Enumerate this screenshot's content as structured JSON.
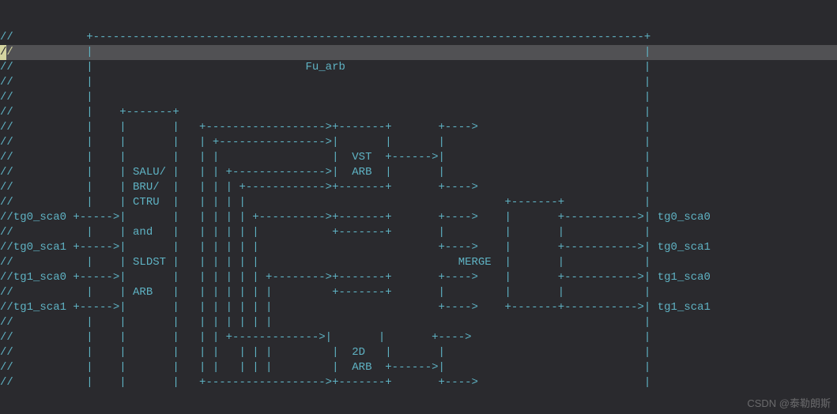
{
  "lines": [
    "//           +-----------------------------------------------------------------------------------+",
    "//           |                                                                                   |",
    "//           |                                Fu_arb                                             |",
    "//           |                                                                                   |",
    "//           |                                                                                   |",
    "//           |    +-------+                                                                      |",
    "//           |    |       |   +------------------>+-------+       +---->                         |",
    "//           |    |       |   | +---------------->|       |       |                              |",
    "//           |    |       |   | |                 |  VST  +------>|                              |",
    "//           |    | SALU/ |   | | +-------------->|  ARB  |       |                              |",
    "//           |    | BRU/  |   | | | +------------>+-------+       +---->                         |",
    "//           |    | CTRU  |   | | | |                                       +-------+            |",
    "//tg0_sca0 +----->|       |   | | | | +---------->+-------+       +---->    |       +----------->| tg0_sca0",
    "//           |    | and   |   | | | | |           +-------+       |         |       |            |",
    "//tg0_sca1 +----->|       |   | | | | |                           +---->    |       +----------->| tg0_sca1",
    "//           |    | SLDST |   | | | | |                              MERGE  |       |            |",
    "//tg1_sca0 +----->|       |   | | | | | +-------->+-------+       +---->    |       +----------->| tg1_sca0",
    "//           |    | ARB   |   | | | | | |         +-------+       |         |       |            |",
    "//tg1_sca1 +----->|       |   | | | | | |                         +---->    +-------+----------->| tg1_sca1",
    "//           |    |       |   | | | | | |                                                        |",
    "//           |    |       |   | | +------------->|       |       +---->                          |",
    "//           |    |       |   | |   | | |         |  2D   |       |                              |",
    "//           |    |       |   | |   | | |         |  ARB  +------>|                              |",
    "//           |    |       |   +------------------>+-------+       +---->                         |"
  ],
  "highlighted_line_index": 1,
  "watermark": "CSDN @泰勒朗斯"
}
